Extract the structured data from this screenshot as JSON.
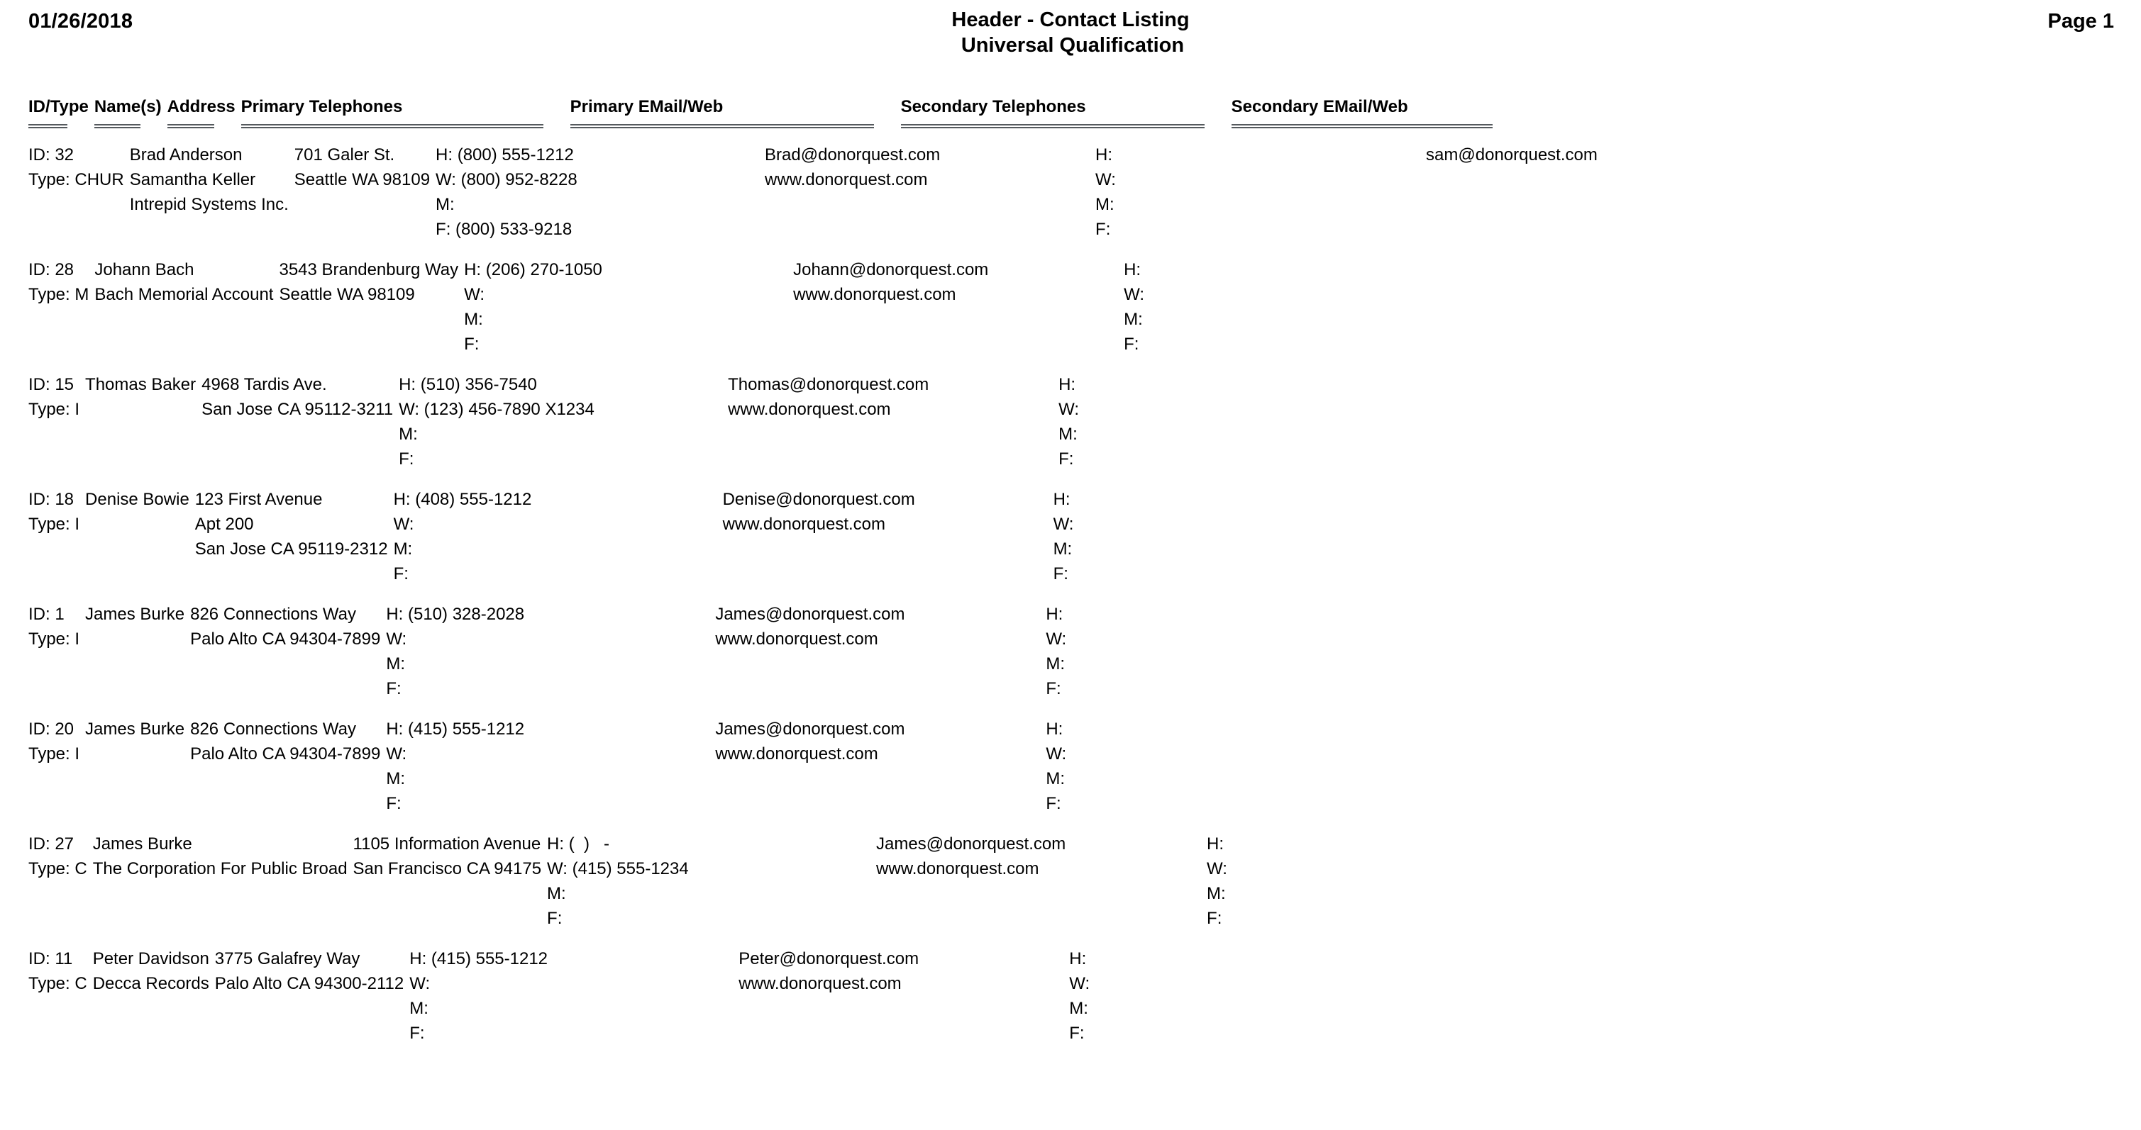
{
  "header": {
    "date": "01/26/2018",
    "title_line1": "Header - Contact Listing",
    "title_line2": "Universal Qualification",
    "page_label": "Page 1"
  },
  "columns": [
    {
      "key": "idtype",
      "label": "ID/Type"
    },
    {
      "key": "names",
      "label": "Name(s)"
    },
    {
      "key": "address",
      "label": "Address"
    },
    {
      "key": "ptel",
      "label": "Primary Telephones"
    },
    {
      "key": "pmail",
      "label": "Primary EMail/Web"
    },
    {
      "key": "stel",
      "label": "Secondary Telephones"
    },
    {
      "key": "smail",
      "label": "Secondary EMail/Web"
    }
  ],
  "rows": [
    {
      "idtype": [
        "ID: 32",
        "Type: CHUR"
      ],
      "names": [
        "Brad Anderson",
        "Samantha Keller",
        "Intrepid Systems Inc."
      ],
      "address": [
        "701 Galer St.",
        "Seattle WA 98109"
      ],
      "ptel": [
        "H: (800) 555-1212",
        "W: (800) 952-8228",
        "M:",
        "F: (800) 533-9218"
      ],
      "pmail": [
        "Brad@donorquest.com",
        "www.donorquest.com"
      ],
      "stel": [
        "H:",
        "W:",
        "M:",
        "F:"
      ],
      "smail": [
        "sam@donorquest.com"
      ]
    },
    {
      "idtype": [
        "ID: 28",
        "Type: M"
      ],
      "names": [
        "Johann Bach",
        "Bach Memorial Account"
      ],
      "address": [
        "3543 Brandenburg Way",
        "Seattle WA 98109"
      ],
      "ptel": [
        "H: (206) 270-1050",
        "W:",
        "M:",
        "F:"
      ],
      "pmail": [
        "Johann@donorquest.com",
        "www.donorquest.com"
      ],
      "stel": [
        "H:",
        "W:",
        "M:",
        "F:"
      ],
      "smail": []
    },
    {
      "idtype": [
        "ID: 15",
        "Type: I"
      ],
      "names": [
        "Thomas Baker"
      ],
      "address": [
        "4968 Tardis Ave.",
        "San Jose CA 95112-3211"
      ],
      "ptel": [
        "H: (510) 356-7540",
        "W: (123) 456-7890 X1234",
        "M:",
        "F:"
      ],
      "pmail": [
        "Thomas@donorquest.com",
        "www.donorquest.com"
      ],
      "stel": [
        "H:",
        "W:",
        "M:",
        "F:"
      ],
      "smail": []
    },
    {
      "idtype": [
        "ID: 18",
        "Type: I"
      ],
      "names": [
        "Denise Bowie"
      ],
      "address": [
        "123 First Avenue",
        "Apt 200",
        "San Jose CA 95119-2312"
      ],
      "ptel": [
        "H: (408) 555-1212",
        "W:",
        "M:",
        "F:"
      ],
      "pmail": [
        "Denise@donorquest.com",
        "www.donorquest.com"
      ],
      "stel": [
        "H:",
        "W:",
        "M:",
        "F:"
      ],
      "smail": []
    },
    {
      "idtype": [
        "ID: 1",
        "Type: I"
      ],
      "names": [
        "James Burke"
      ],
      "address": [
        "826 Connections Way",
        "Palo Alto CA 94304-7899"
      ],
      "ptel": [
        "H: (510) 328-2028",
        "W:",
        "M:",
        "F:"
      ],
      "pmail": [
        "James@donorquest.com",
        "www.donorquest.com"
      ],
      "stel": [
        "H:",
        "W:",
        "M:",
        "F:"
      ],
      "smail": []
    },
    {
      "idtype": [
        "ID: 20",
        "Type: I"
      ],
      "names": [
        "James Burke"
      ],
      "address": [
        "826 Connections Way",
        "Palo Alto CA 94304-7899"
      ],
      "ptel": [
        "H: (415) 555-1212",
        "W:",
        "M:",
        "F:"
      ],
      "pmail": [
        "James@donorquest.com",
        "www.donorquest.com"
      ],
      "stel": [
        "H:",
        "W:",
        "M:",
        "F:"
      ],
      "smail": []
    },
    {
      "idtype": [
        "ID: 27",
        "Type: C"
      ],
      "names": [
        "James Burke",
        "The Corporation For Public Broad"
      ],
      "address": [
        "1105 Information Avenue",
        "San Francisco CA 94175"
      ],
      "ptel": [
        "H: (  )   -",
        "W: (415) 555-1234",
        "M:",
        "F:"
      ],
      "pmail": [
        "James@donorquest.com",
        "www.donorquest.com"
      ],
      "stel": [
        "H:",
        "W:",
        "M:",
        "F:"
      ],
      "smail": []
    },
    {
      "idtype": [
        "ID: 11",
        "Type: C"
      ],
      "names": [
        "Peter Davidson",
        "Decca Records"
      ],
      "address": [
        "3775 Galafrey Way",
        "Palo Alto CA 94300-2112"
      ],
      "ptel": [
        "H: (415) 555-1212",
        "W:",
        "M:",
        "F:"
      ],
      "pmail": [
        "Peter@donorquest.com",
        "www.donorquest.com"
      ],
      "stel": [
        "H:",
        "W:",
        "M:",
        "F:"
      ],
      "smail": []
    }
  ]
}
